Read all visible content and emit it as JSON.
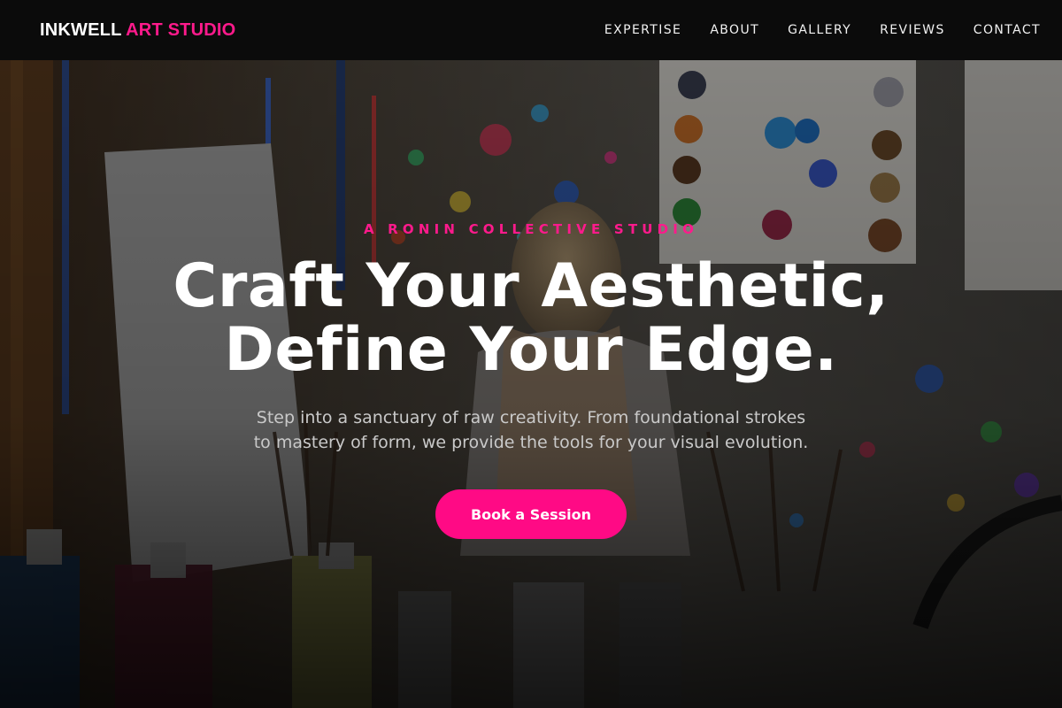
{
  "header": {
    "brand_primary": "INKWELL",
    "brand_accent": "ART STUDIO",
    "nav": [
      {
        "label": "EXPERTISE"
      },
      {
        "label": "ABOUT"
      },
      {
        "label": "GALLERY"
      },
      {
        "label": "REVIEWS"
      },
      {
        "label": "CONTACT"
      }
    ]
  },
  "hero": {
    "kicker": "A RONIN COLLECTIVE STUDIO",
    "headline_line1": "Craft Your Aesthetic,",
    "headline_line2": "Define Your Edge.",
    "subtitle_line1": "Step into a sanctuary of raw creativity. From foundational strokes",
    "subtitle_line2": "to mastery of form, we provide the tools for your visual evolution.",
    "cta_label": "Book a Session",
    "background": "art-studio-photo"
  },
  "colors": {
    "accent": "#ff1a8c",
    "button": "#ff0a85",
    "nav_background": "#0b0b0b",
    "text": "#ffffff"
  }
}
